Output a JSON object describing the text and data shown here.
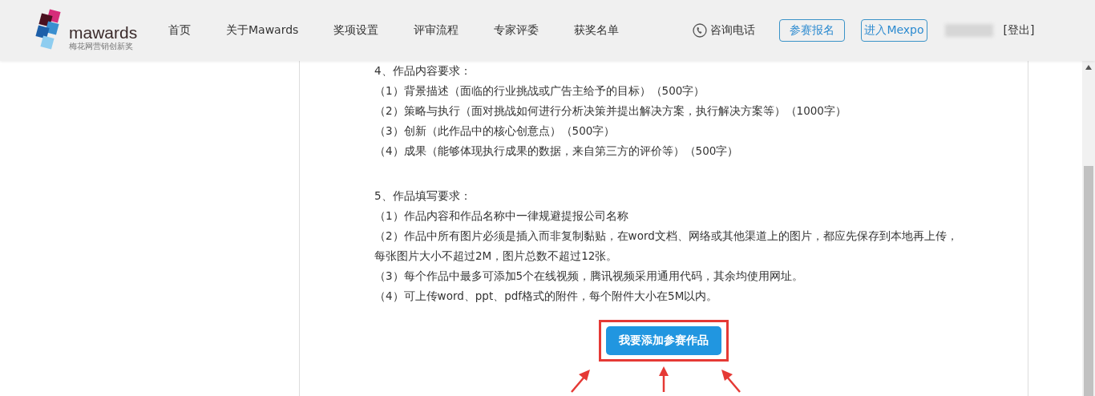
{
  "header": {
    "logo": {
      "name": "mawards",
      "tagline": "梅花网营销创新奖"
    },
    "nav": [
      {
        "label": "首页"
      },
      {
        "label": "关于Mawards"
      },
      {
        "label": "奖项设置"
      },
      {
        "label": "评审流程"
      },
      {
        "label": "专家评委"
      },
      {
        "label": "获奖名单"
      }
    ],
    "phone": "咨询电话",
    "buttons": [
      "参赛报名",
      "进入Mexpo"
    ],
    "logout": "[登出]"
  },
  "sections": [
    {
      "heading": "4、作品内容要求：",
      "lines": [
        "（1）背景描述（面临的行业挑战或广告主给予的目标）（500字）",
        "（2）策略与执行（面对挑战如何进行分析决策并提出解决方案，执行解决方案等）（1000字）",
        "（3）创新（此作品中的核心创意点）（500字）",
        "（4）成果（能够体现执行成果的数据，来自第三方的评价等）（500字）"
      ]
    },
    {
      "heading": "5、作品填写要求：",
      "lines": [
        "（1）作品内容和作品名称中一律规避提报公司名称",
        "（2）作品中所有图片必须是插入而非复制黏贴，在word文档、网络或其他渠道上的图片，都应先保存到本地再上传，每张图片大小不超过2M，图片总数不超过12张。",
        "（3）每个作品中最多可添加5个在线视频，腾讯视频采用通用代码，其余均使用网址。",
        "（4）可上传word、ppt、pdf格式的附件，每个附件大小在5M以内。"
      ]
    }
  ],
  "action_button": "我要添加参赛作品"
}
